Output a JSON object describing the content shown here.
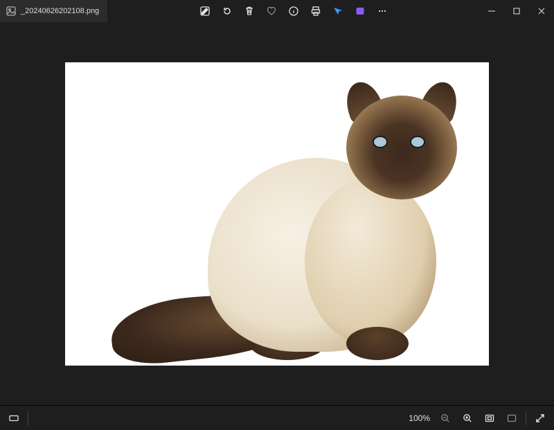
{
  "tab": {
    "filename": "_20240626202108.png"
  },
  "toolbar": {
    "edit": "Edit image",
    "rotate": "Rotate",
    "delete": "Delete",
    "favorite": "Favorite",
    "info": "Image info",
    "print": "Print",
    "visual_search": "Visual search",
    "clipchamp": "Edit in Clipchamp",
    "more": "See more"
  },
  "window_controls": {
    "minimize": "Minimize",
    "maximize": "Maximize",
    "close": "Close"
  },
  "status": {
    "filmstrip": "Filmstrip",
    "zoom_percent": "100%",
    "zoom_out": "Zoom out",
    "zoom_in": "Zoom in",
    "fit": "Fit to window",
    "actual": "Actual size",
    "fullscreen": "Full screen"
  },
  "image": {
    "alt": "Fluffy Himalayan cat with dark face, ears, paws and tail sitting on white background"
  }
}
